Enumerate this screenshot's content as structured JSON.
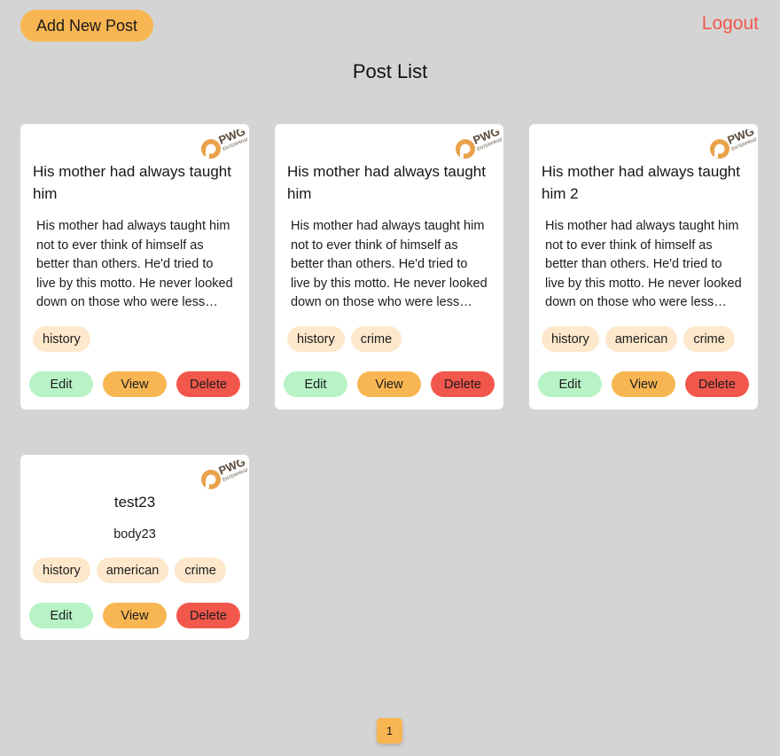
{
  "header": {
    "add_label": "Add New Post",
    "logout_label": "Logout",
    "title": "Post List"
  },
  "colors": {
    "accent": "#f8b652",
    "danger": "#f2574c",
    "edit": "#b7f3c5",
    "tag": "#fde8cc",
    "background": "#d4d4d4"
  },
  "logo": {
    "text_main": "PWG",
    "text_sub": "ENTERPRISE",
    "icon": "pwg-logo-icon"
  },
  "posts": [
    {
      "title": "His mother had always taught him",
      "body": "His mother had always taught him not to ever think of himself as better than others. He'd tried to live by this motto. He never looked down on those who were less…",
      "tags": [
        "history"
      ]
    },
    {
      "title": "His mother had always taught him",
      "body": "His mother had always taught him not to ever think of himself as better than others. He'd tried to live by this motto. He never looked down on those who were less…",
      "tags": [
        "history",
        "crime"
      ]
    },
    {
      "title": "His mother had always taught him 2",
      "body": "His mother had always taught him not to ever think of himself as better than others. He'd tried to live by this motto. He never looked down on those who were less…",
      "tags": [
        "history",
        "american",
        "crime"
      ]
    },
    {
      "title": "test23",
      "body": "body23",
      "tags": [
        "history",
        "american",
        "crime"
      ]
    }
  ],
  "actions": {
    "edit": "Edit",
    "view": "View",
    "delete": "Delete"
  },
  "pagination": {
    "current": "1"
  }
}
